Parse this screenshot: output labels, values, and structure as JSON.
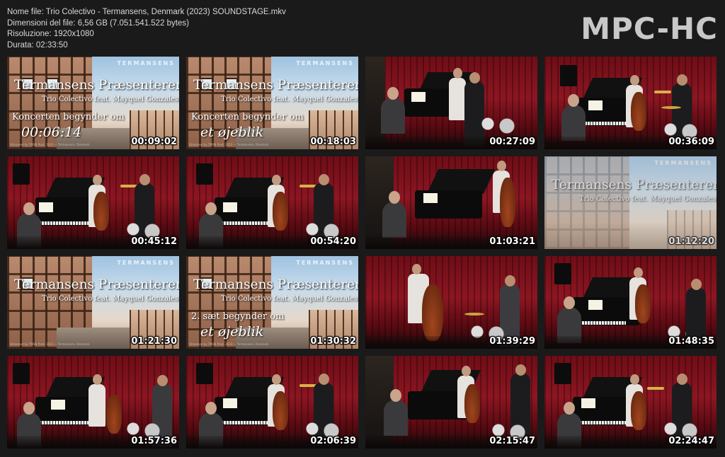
{
  "meta": {
    "filename": "Nome file: Trio Colectivo - Termansens, Denmark (2023) SOUNDSTAGE.mkv",
    "filesize": "Dimensioni del file: 6,56 GB (7.051.541.522 bytes)",
    "resolution": "Risoluzione: 1920x1080",
    "duration": "Durata: 02:33:50"
  },
  "logo": "MPC-HC",
  "brand": "TERMANSENS",
  "title_slide": {
    "title": "Termansens Præsenterer:",
    "subtitle": "Trio Colectivo feat. Mayquel Gonzales",
    "concert_begins": "Koncerten begynder om",
    "countdown": "00:06:14",
    "moment": "et øjeblik",
    "set2_begins": "2. sæt begynder om"
  },
  "credit": "Streamed by TMSN Prod. 2023 — Termansens, Denmark",
  "thumbnails": [
    {
      "time": "00:09:02"
    },
    {
      "time": "00:18:03"
    },
    {
      "time": "00:27:09"
    },
    {
      "time": "00:36:09"
    },
    {
      "time": "00:45:12"
    },
    {
      "time": "00:54:20"
    },
    {
      "time": "01:03:21"
    },
    {
      "time": "01:12:20"
    },
    {
      "time": "01:21:30"
    },
    {
      "time": "01:30:32"
    },
    {
      "time": "01:39:29"
    },
    {
      "time": "01:48:35"
    },
    {
      "time": "01:57:36"
    },
    {
      "time": "02:06:39"
    },
    {
      "time": "02:15:47"
    },
    {
      "time": "02:24:47"
    }
  ]
}
